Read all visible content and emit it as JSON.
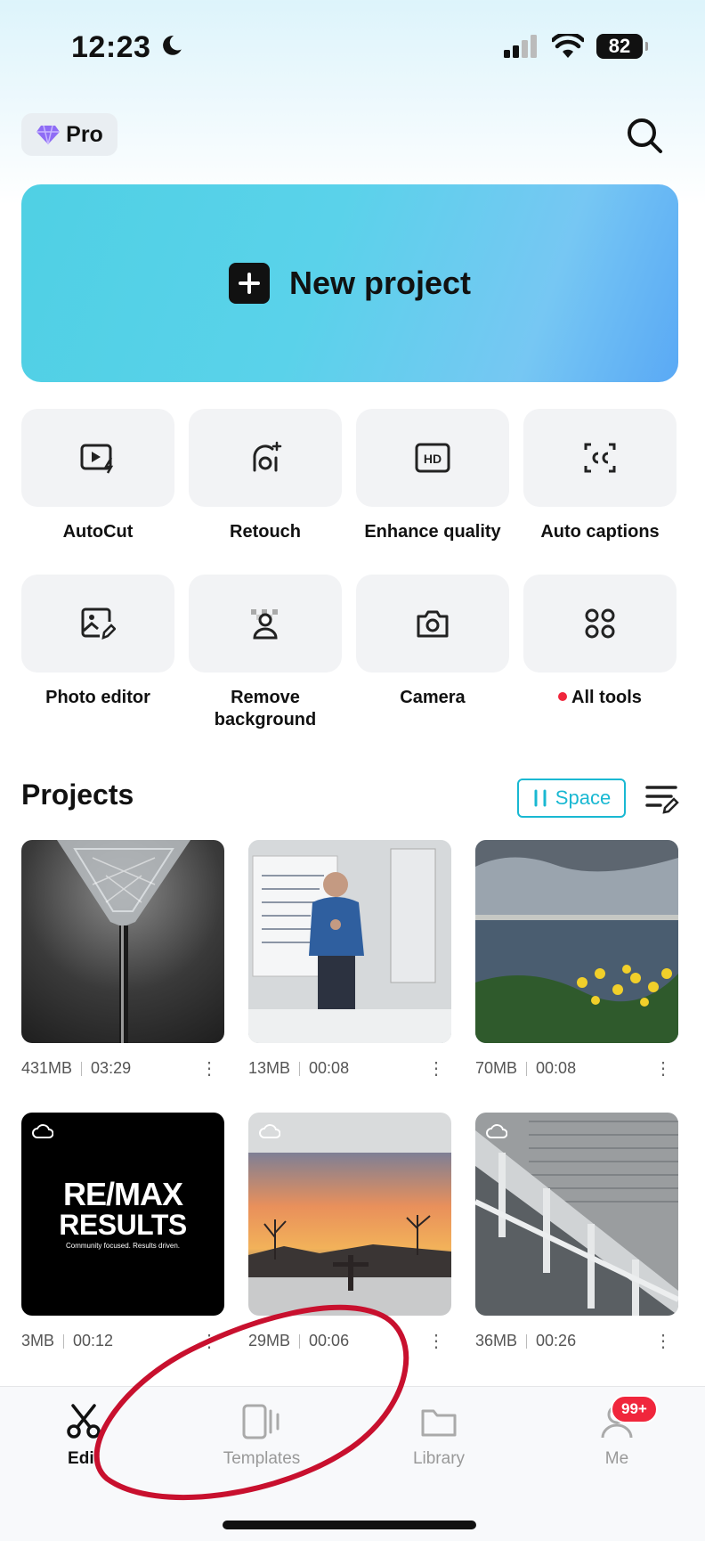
{
  "status_bar": {
    "time": "12:23",
    "battery": "82"
  },
  "header": {
    "pro_label": "Pro"
  },
  "banner": {
    "label": "New project"
  },
  "tools": [
    {
      "label": "AutoCut",
      "icon": "autocut-icon"
    },
    {
      "label": "Retouch",
      "icon": "retouch-icon"
    },
    {
      "label": "Enhance quality",
      "icon": "hd-icon"
    },
    {
      "label": "Auto captions",
      "icon": "captions-icon"
    },
    {
      "label": "Photo editor",
      "icon": "photo-editor-icon"
    },
    {
      "label": "Remove background",
      "icon": "remove-background-icon"
    },
    {
      "label": "Camera",
      "icon": "camera-icon"
    },
    {
      "label": "All tools",
      "icon": "all-tools-icon"
    }
  ],
  "projects": {
    "title": "Projects",
    "space_label": "Space",
    "items": [
      {
        "size": "431MB",
        "duration": "03:29"
      },
      {
        "size": "13MB",
        "duration": "00:08"
      },
      {
        "size": "70MB",
        "duration": "00:08"
      },
      {
        "size": "3MB",
        "duration": "00:12",
        "logo_line1": "RE/MAX",
        "logo_line2": "RESULTS",
        "logo_tagline": "Community focused. Results driven."
      },
      {
        "size": "29MB",
        "duration": "00:06"
      },
      {
        "size": "36MB",
        "duration": "00:26"
      }
    ]
  },
  "nav": {
    "edit": "Edit",
    "templates": "Templates",
    "library": "Library",
    "me": "Me",
    "me_badge": "99+"
  },
  "colors": {
    "accent": "#19b8d2",
    "badge": "#f0263c",
    "banner_start": "#4fd0e4",
    "banner_end": "#5aa9f5",
    "annotation": "#c8102e"
  }
}
